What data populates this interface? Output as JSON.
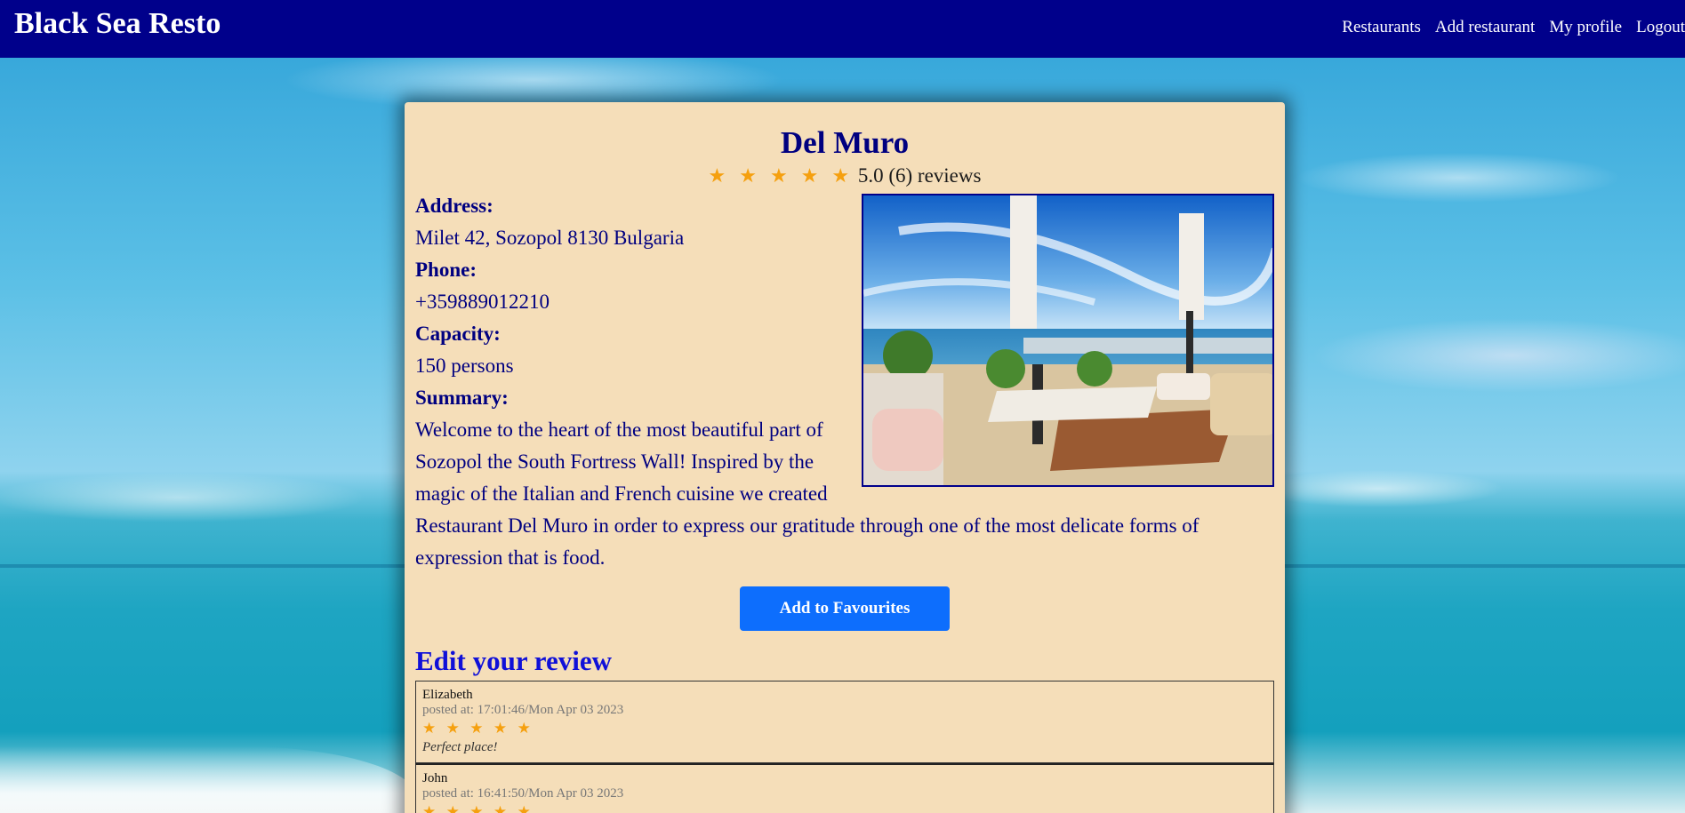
{
  "navbar": {
    "brand": "Black Sea Resto",
    "links": [
      "Restaurants",
      "Add restaurant",
      "My profile",
      "Logout"
    ]
  },
  "restaurant": {
    "name": "Del Muro",
    "stars": "★ ★ ★ ★ ★",
    "rating_text": "5.0 (6) reviews",
    "address_label": "Address:",
    "address": "Milet 42, Sozopol 8130 Bulgaria",
    "phone_label": "Phone:",
    "phone": "+359889012210",
    "capacity_label": "Capacity:",
    "capacity": "150 persons",
    "summary_label": "Summary:",
    "summary": "Welcome to the heart of the most beautiful part of Sozopol the South Fortress Wall! Inspired by the magic of the Italian and French cuisine we created Restaurant Del Muro in order to express our gratitude through one of the most delicate forms of expression that is food."
  },
  "actions": {
    "favourite_label": "Add to Favourites"
  },
  "reviews_section": {
    "title": "Edit your review",
    "reviews": [
      {
        "name": "Elizabeth",
        "time": "posted at: 17:01:46/Mon Apr 03 2023",
        "stars": "★ ★ ★ ★ ★",
        "text": "Perfect place!"
      },
      {
        "name": "John",
        "time": "posted at: 16:41:50/Mon Apr 03 2023",
        "stars": "★ ★ ★ ★ ★",
        "text": ""
      }
    ]
  },
  "colors": {
    "navbar": "#00008b",
    "card": "#f5deb9",
    "text": "#000080",
    "button": "#0d6efd",
    "star": "#f5a00f"
  }
}
